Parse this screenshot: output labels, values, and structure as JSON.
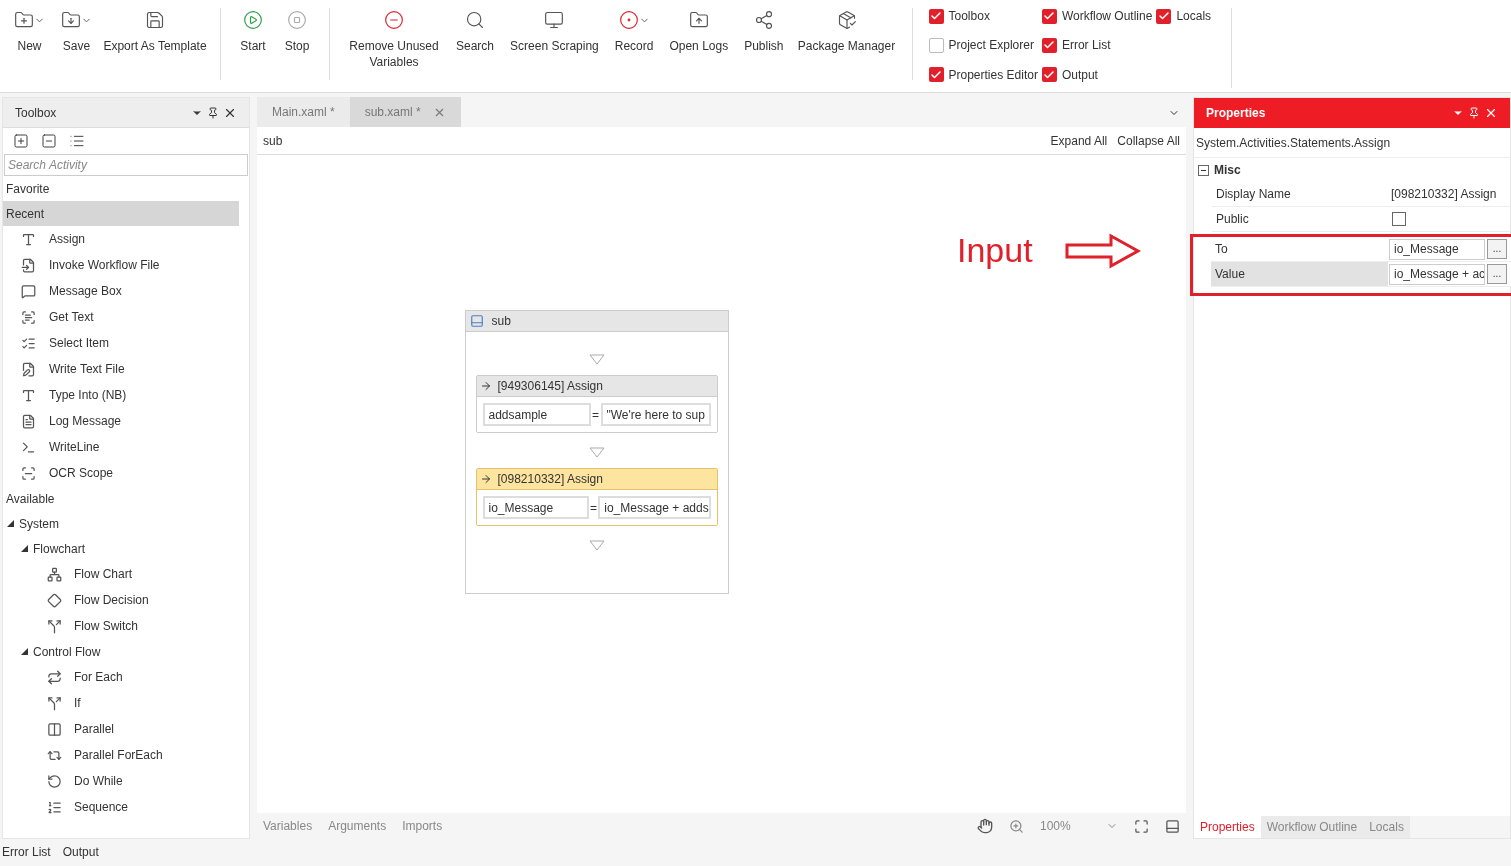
{
  "toolbar": {
    "groups": [
      [
        {
          "label": "New",
          "dropdown": true
        },
        {
          "label": "Save",
          "dropdown": true
        },
        {
          "label": "Export As Template",
          "dropdown": false
        }
      ],
      [
        {
          "label": "Start",
          "dropdown": false
        },
        {
          "label": "Stop",
          "dropdown": false
        }
      ],
      [
        {
          "label": "Remove Unused Variables",
          "dropdown": false
        },
        {
          "label": "Search",
          "dropdown": false
        },
        {
          "label": "Screen Scraping",
          "dropdown": false
        },
        {
          "label": "Record",
          "dropdown": true
        },
        {
          "label": "Open Logs",
          "dropdown": false
        },
        {
          "label": "Publish",
          "dropdown": false
        },
        {
          "label": "Package Manager",
          "dropdown": false
        }
      ]
    ],
    "panels": [
      {
        "label": "Toolbox",
        "checked": true
      },
      {
        "label": "Project Explorer",
        "checked": false
      },
      {
        "label": "Properties Editor",
        "checked": true
      },
      {
        "label": "Workflow Outline",
        "checked": true
      },
      {
        "label": "Error List",
        "checked": true
      },
      {
        "label": "Output",
        "checked": true
      },
      {
        "label": "Locals",
        "checked": true
      }
    ]
  },
  "toolbox": {
    "title": "Toolbox",
    "search": {
      "placeholder": "Search Activity"
    },
    "sections": [
      {
        "label": "Favorite",
        "selected": false
      },
      {
        "label": "Recent",
        "selected": true,
        "items": [
          "Assign",
          "Invoke Workflow File",
          "Message Box",
          "Get Text",
          "Select Item",
          "Write Text File",
          "Type Into (NB)",
          "Log Message",
          "WriteLine",
          "OCR Scope"
        ]
      },
      {
        "label": "Available",
        "selected": false,
        "children": [
          {
            "label": "System",
            "expanded": true,
            "children": [
              {
                "label": "Flowchart",
                "expanded": true,
                "children": [
                  {
                    "label": "Flow Chart"
                  },
                  {
                    "label": "Flow Decision"
                  },
                  {
                    "label": "Flow Switch"
                  }
                ]
              },
              {
                "label": "Control Flow",
                "expanded": true,
                "children": [
                  {
                    "label": "For Each"
                  },
                  {
                    "label": "If"
                  },
                  {
                    "label": "Parallel"
                  },
                  {
                    "label": "Parallel ForEach"
                  },
                  {
                    "label": "Do While"
                  },
                  {
                    "label": "Sequence"
                  }
                ]
              }
            ]
          }
        ]
      }
    ]
  },
  "designer": {
    "tabs": [
      {
        "label": "Main.xaml *",
        "selected": false,
        "closable": false
      },
      {
        "label": "sub.xaml *",
        "selected": true,
        "closable": true
      }
    ],
    "breadcrumb": "sub",
    "expand_all": "Expand All",
    "collapse_all": "Collapse All",
    "sequence": {
      "title": "sub",
      "activities": [
        {
          "title": "[949306145] Assign",
          "to": "addsample",
          "operator": "=",
          "value": "\"We're here to sup",
          "selected": false
        },
        {
          "title": "[098210332] Assign",
          "to": "io_Message",
          "operator": "=",
          "value": "io_Message + adds",
          "selected": true
        }
      ]
    },
    "annotation": {
      "text": "Input"
    },
    "bottom_tabs": [
      "Variables",
      "Arguments",
      "Imports"
    ],
    "zoom": "100%"
  },
  "properties": {
    "title": "Properties",
    "type_name": "System.Activities.Statements.Assign",
    "category": {
      "label": "Misc",
      "expanded": true
    },
    "rows": [
      {
        "kind": "text",
        "label": "Display Name",
        "value": "[098210332] Assign",
        "selected": false,
        "highlighted": false
      },
      {
        "kind": "checkbox",
        "label": "Public",
        "checked": false,
        "selected": false,
        "highlighted": false
      },
      {
        "kind": "field",
        "label": "To",
        "value": "io_Message",
        "button": "...",
        "selected": false,
        "highlighted": true
      },
      {
        "kind": "field",
        "label": "Value",
        "value": "io_Message + ac",
        "button": "...",
        "selected": true,
        "highlighted": true
      }
    ],
    "tabs": [
      {
        "label": "Properties",
        "selected": true
      },
      {
        "label": "Workflow Outline",
        "selected": false
      },
      {
        "label": "Locals",
        "selected": false
      }
    ]
  },
  "bottom_tabs": [
    "Error List",
    "Output"
  ]
}
